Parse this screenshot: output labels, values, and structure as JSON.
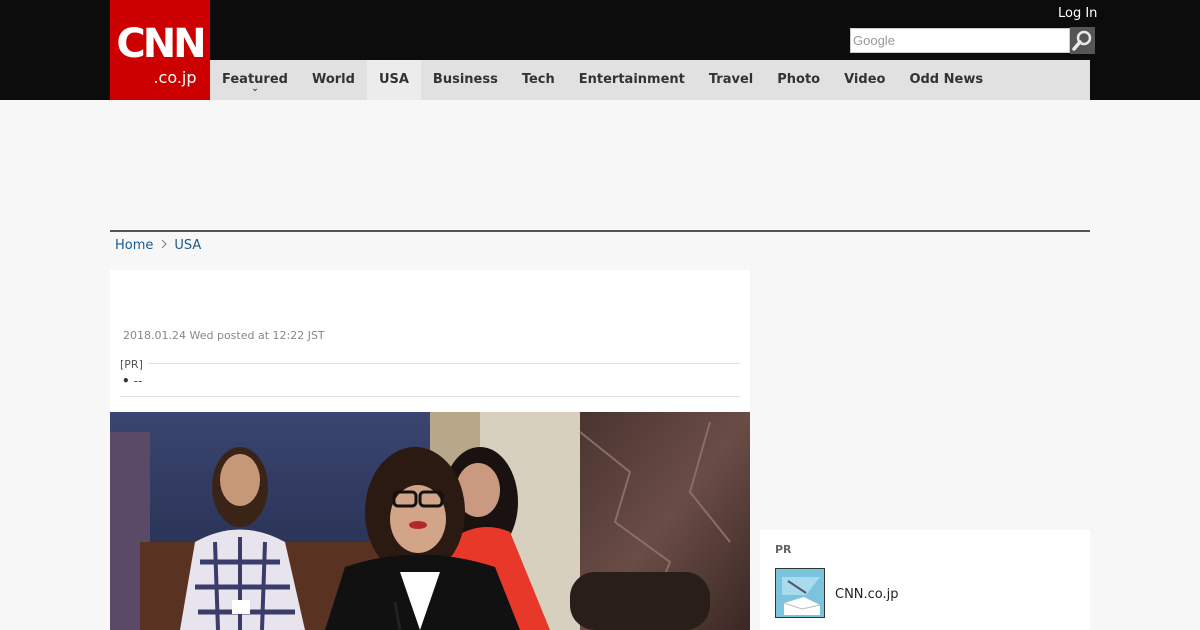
{
  "header": {
    "logo_main": "CNN",
    "logo_sub": ".co.jp",
    "login_label": "Log In",
    "search_placeholder": "Google"
  },
  "nav": {
    "items": [
      {
        "label": "Featured"
      },
      {
        "label": "World"
      },
      {
        "label": "USA"
      },
      {
        "label": "Business"
      },
      {
        "label": "Tech"
      },
      {
        "label": "Entertainment"
      },
      {
        "label": "Travel"
      },
      {
        "label": "Photo"
      },
      {
        "label": "Video"
      },
      {
        "label": "Odd News"
      }
    ],
    "active": "USA"
  },
  "breadcrumb": {
    "home": "Home",
    "current": "USA"
  },
  "article": {
    "posted": "2018.01.24 Wed posted at 12:22 JST",
    "pr_label": "[PR]",
    "pr_link_bullet": "•",
    "pr_link_text": "--"
  },
  "sidebar": {
    "pr_heading": "PR",
    "item_name": "CNN.co.jp"
  },
  "colors": {
    "brand_red": "#cc0000",
    "header_black": "#0c0c0c",
    "nav_gray": "#e1e1e1",
    "link_blue": "#1a5a8c"
  }
}
